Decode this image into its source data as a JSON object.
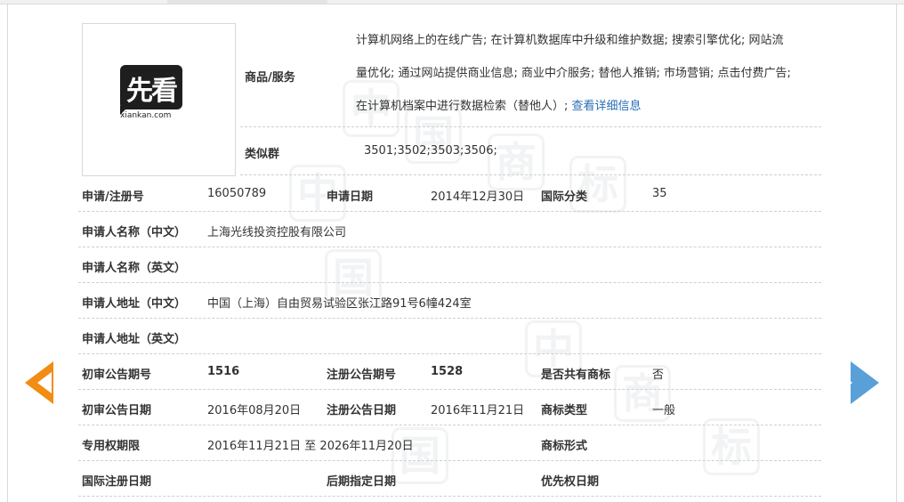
{
  "logo": {
    "mark": "先看",
    "sub": "xiankan.com"
  },
  "goods": {
    "label": "商品/服务",
    "lines": [
      "计算机网络上的在线广告; 在计算机数据库中升级和维护数据; 搜索引擎优化; 网站流",
      "量优化; 通过网站提供商业信息; 商业中介服务; 替他人推销; 市场营销; 点击付费广告;",
      "在计算机档案中进行数据检索（替他人）;"
    ],
    "detail_link": "查看详细信息"
  },
  "similar": {
    "label": "类似群",
    "value": "3501;3502;3503;3506;"
  },
  "rows": {
    "reg_no": {
      "label": "申请/注册号",
      "value": "16050789"
    },
    "app_date": {
      "label": "申请日期",
      "value": "2014年12月30日"
    },
    "intl_class": {
      "label": "国际分类",
      "value": "35"
    },
    "applicant_cn": {
      "label": "申请人名称（中文）",
      "value": "上海光线投资控股有限公司"
    },
    "applicant_en": {
      "label": "申请人名称（英文）",
      "value": ""
    },
    "address_cn": {
      "label": "申请人地址（中文）",
      "value": "中国（上海）自由贸易试验区张江路91号6幢424室"
    },
    "address_en": {
      "label": "申请人地址（英文）",
      "value": ""
    },
    "prelim_no": {
      "label": "初审公告期号",
      "value": "1516"
    },
    "reg_pub_no": {
      "label": "注册公告期号",
      "value": "1528"
    },
    "shared": {
      "label": "是否共有商标",
      "value": "否"
    },
    "prelim_date": {
      "label": "初审公告日期",
      "value": "2016年08月20日"
    },
    "reg_pub_date": {
      "label": "注册公告日期",
      "value": "2016年11月21日"
    },
    "mark_type": {
      "label": "商标类型",
      "value": "一般"
    },
    "term": {
      "label": "专用权期限",
      "value": "2016年11月21日 至 2026年11月20日"
    },
    "mark_form": {
      "label": "商标形式",
      "value": ""
    },
    "intl_reg_date": {
      "label": "国际注册日期",
      "value": ""
    },
    "later_date": {
      "label": "后期指定日期",
      "value": ""
    },
    "priority_date": {
      "label": "优先权日期",
      "value": ""
    }
  },
  "watermark": [
    "中",
    "国",
    "商",
    "标"
  ],
  "colors": {
    "arrow_prev": "#f28c14",
    "arrow_next": "#5aa0d8",
    "link": "#2a6eb8"
  },
  "nav": {
    "prev_icon": "arrow-left-icon",
    "next_icon": "arrow-right-icon"
  }
}
